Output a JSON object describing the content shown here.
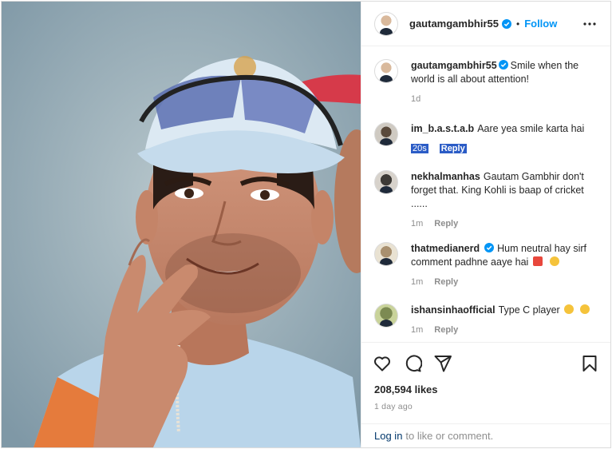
{
  "post": {
    "author": "gautamgambhir55",
    "follow_label": "Follow",
    "dot": "•",
    "caption": "Smile when the world is all about attention!",
    "caption_age": "1d",
    "image_icon": "photo-of-smiling-cricketer"
  },
  "comments": [
    {
      "user": "im_b.a.s.t.a.b",
      "text": "Aare yea smile karta hai",
      "age": "20s",
      "reply": "Reply",
      "verified": false,
      "highlighted": true
    },
    {
      "user": "nekhalmanhas",
      "text": "Gautam Gambhir don't forget that. King Kohli is baap of cricket ......",
      "age": "1m",
      "reply": "Reply",
      "verified": false
    },
    {
      "user": "thatmedianerd",
      "text": "Hum neutral hay sirf comment padhne aaye hai",
      "age": "1m",
      "reply": "Reply",
      "verified": true
    },
    {
      "user": "ishansinhaofficial",
      "text": "Type C player",
      "age": "1m",
      "reply": "Reply",
      "verified": false
    }
  ],
  "actions": {
    "like_icon": "heart-icon",
    "comment_icon": "comment-icon",
    "share_icon": "paper-plane-icon",
    "save_icon": "bookmark-icon"
  },
  "likes": "208,594 likes",
  "posted": "1 day ago",
  "login": {
    "link": "Log in",
    "text": "to like or comment."
  },
  "colors": {
    "accent": "#0095f6",
    "verified": "#0095f6",
    "highlight": "#2b5cc6"
  }
}
